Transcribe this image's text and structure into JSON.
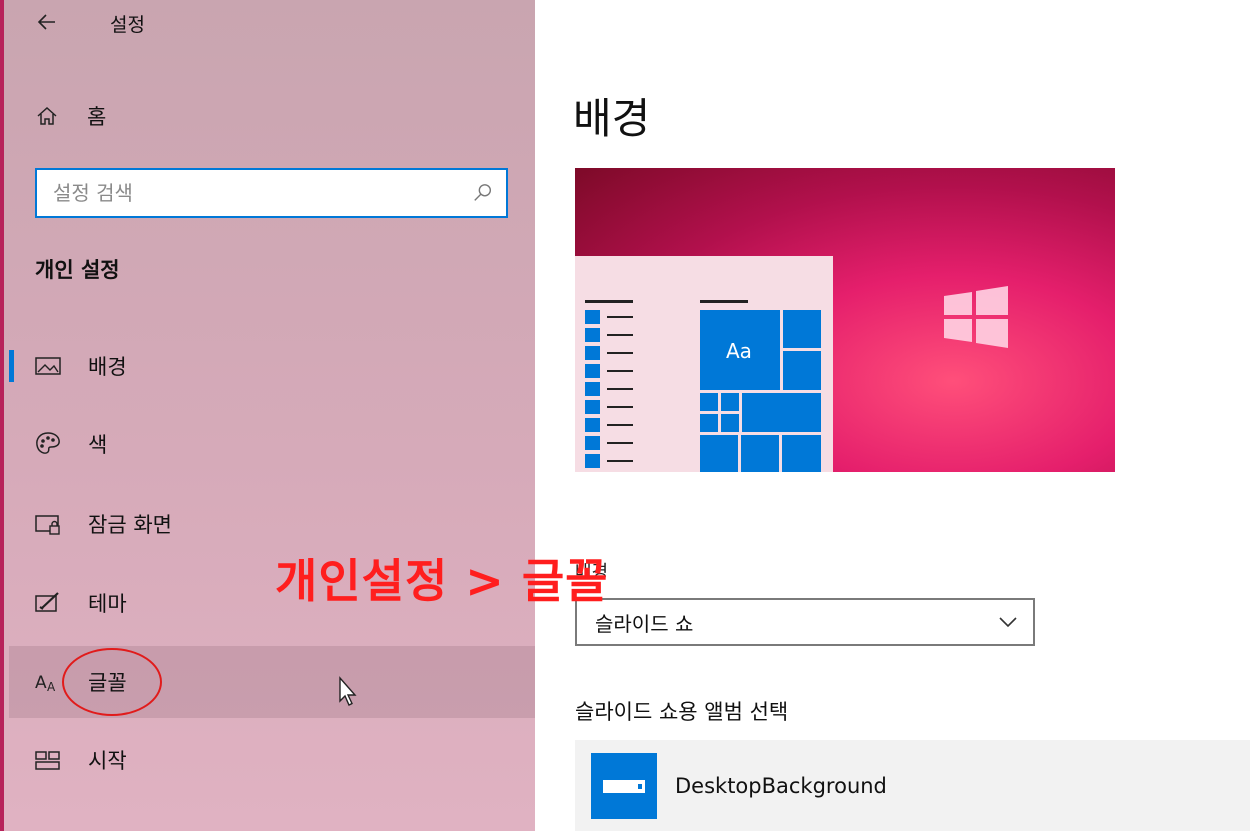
{
  "header": {
    "title": "설정"
  },
  "sidebar": {
    "home_label": "홈",
    "search_placeholder": "설정 검색",
    "section_title": "개인 설정",
    "items": [
      {
        "label": "배경",
        "icon": "picture-icon"
      },
      {
        "label": "색",
        "icon": "palette-icon"
      },
      {
        "label": "잠금 화면",
        "icon": "lock-screen-icon"
      },
      {
        "label": "테마",
        "icon": "theme-icon"
      },
      {
        "label": "글꼴",
        "icon": "font-icon"
      },
      {
        "label": "시작",
        "icon": "start-icon"
      }
    ],
    "active_item": "배경",
    "hovered_item": "글꼴"
  },
  "annotation": {
    "text": "개인설정 > 글꼴",
    "color": "#ff1e1e"
  },
  "main": {
    "title": "배경",
    "preview": {
      "tile_text": "Aa"
    },
    "background_label": "배경",
    "background_value": "슬라이드 쇼",
    "album_label": "슬라이드 쇼용 앨범 선택",
    "album_name": "DesktopBackground"
  },
  "colors": {
    "accent": "#0078d7",
    "sidebar_edge": "#b7225a"
  }
}
